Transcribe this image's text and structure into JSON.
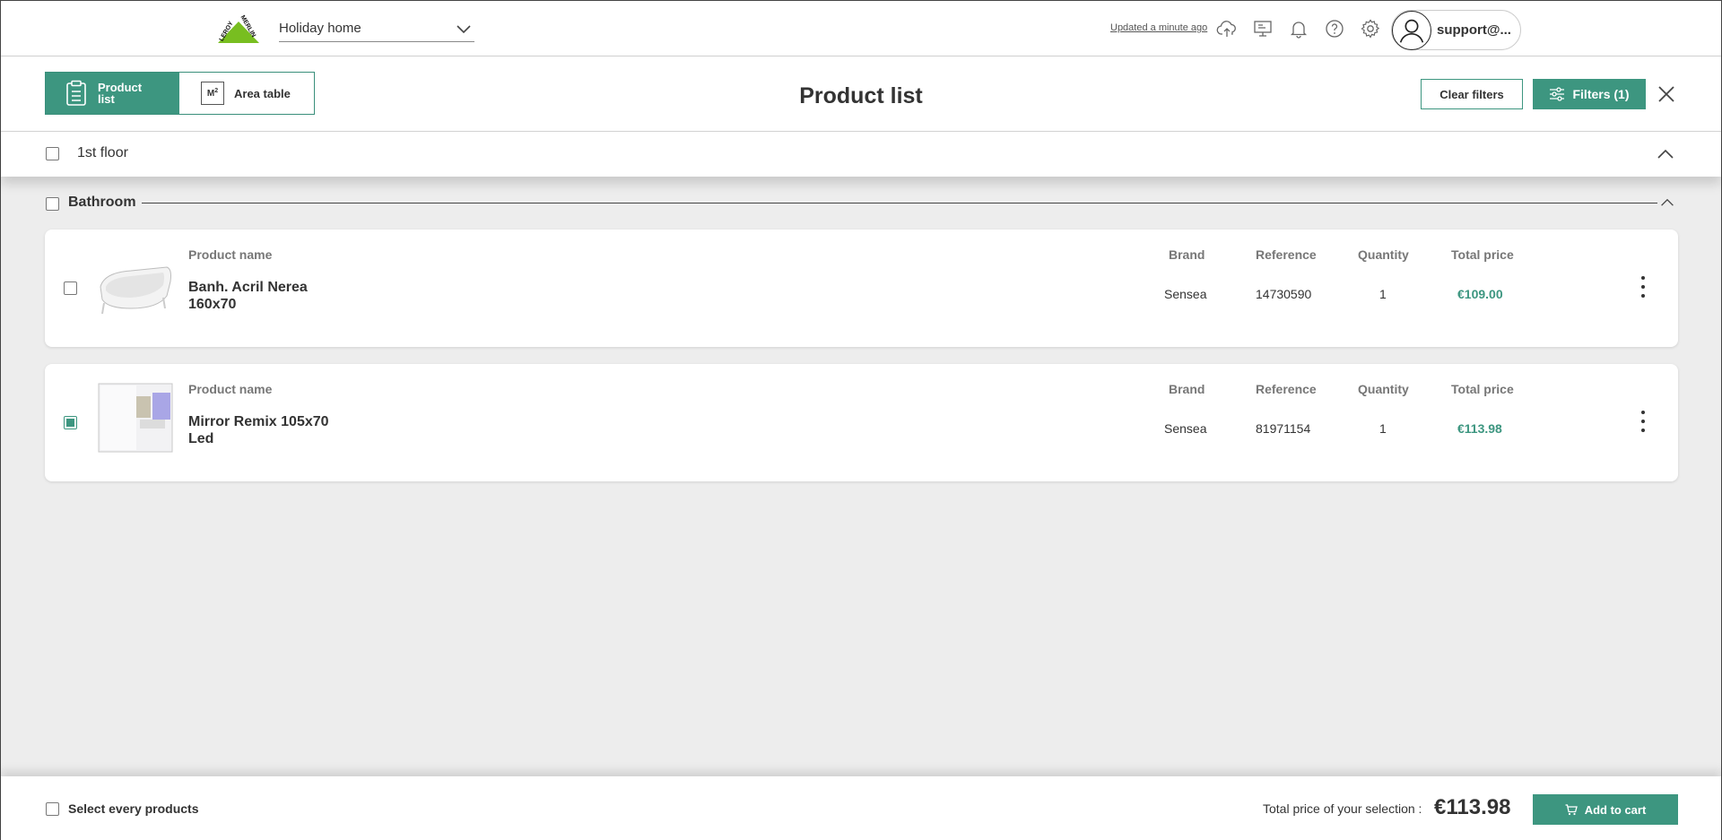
{
  "header": {
    "project_selected": "Holiday home",
    "updated_text": "Updated a minute ago",
    "user_name": "support@..."
  },
  "panel": {
    "tabs": [
      {
        "label": "Product list",
        "active": true,
        "icon": "clipboard-icon"
      },
      {
        "label": "Area table",
        "active": false,
        "icon": "m2-icon",
        "icon_text": "M",
        "icon_sup": "2"
      }
    ],
    "title": "Product list",
    "clear_filters_label": "Clear filters",
    "filters_label": "Filters (1)"
  },
  "floor": {
    "label": "1st floor",
    "checked": false,
    "expanded": true
  },
  "room": {
    "label": "Bathroom",
    "checked": false,
    "expanded": true
  },
  "columns": {
    "name": "Product name",
    "brand": "Brand",
    "reference": "Reference",
    "quantity": "Quantity",
    "total_price": "Total price"
  },
  "products": [
    {
      "name": "Banh. Acril Nerea 160x70",
      "brand": "Sensea",
      "reference": "14730590",
      "quantity": "1",
      "total_price": "€109.00",
      "checked": false
    },
    {
      "name": "Mirror Remix 105x70 Led",
      "brand": "Sensea",
      "reference": "81971154",
      "quantity": "1",
      "total_price": "€113.98",
      "checked": true
    }
  ],
  "footer": {
    "select_all_label": "Select every products",
    "total_label": "Total price of your selection :",
    "total_value": "€113.98",
    "add_to_cart_label": "Add to cart"
  },
  "colors": {
    "accent": "#3d9680",
    "logo_green": "#78be20",
    "background": "#ededed"
  }
}
